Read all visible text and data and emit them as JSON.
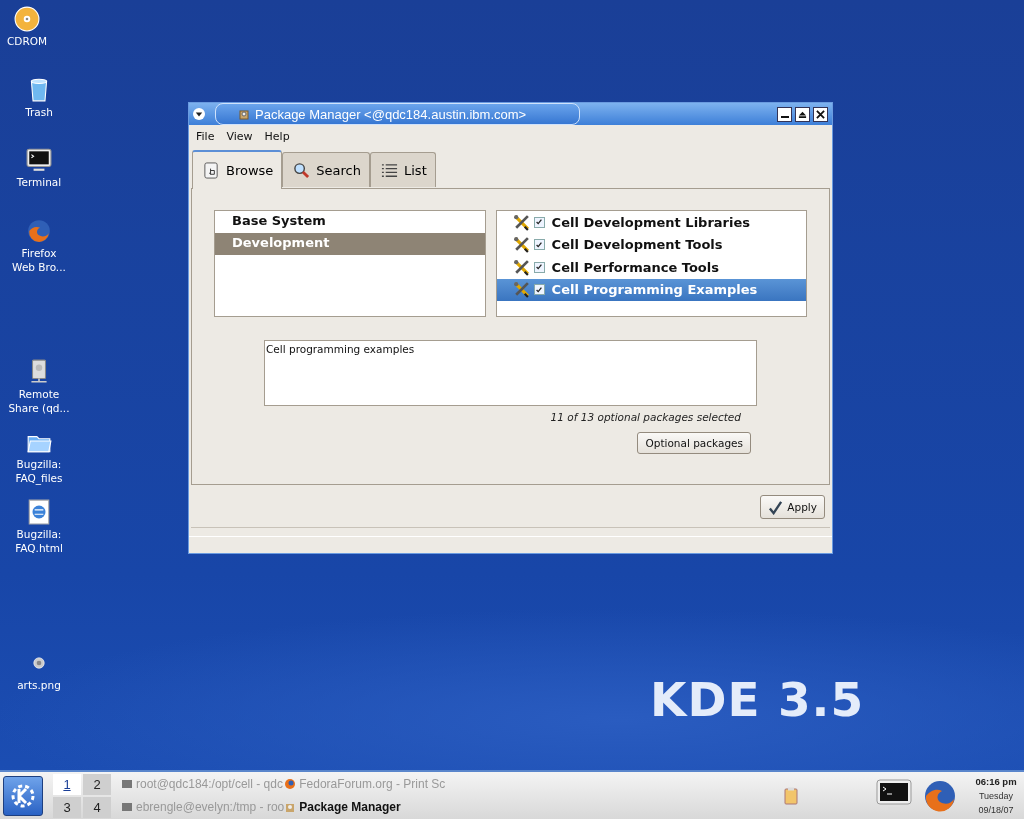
{
  "desktop_icons": [
    {
      "kind": "cdrom",
      "label": [
        "CDROM"
      ]
    },
    {
      "kind": "trash",
      "label": [
        "Trash"
      ]
    },
    {
      "kind": "terminal",
      "label": [
        "Terminal"
      ]
    },
    {
      "kind": "firefox",
      "label": [
        "Firefox",
        "Web Bro..."
      ]
    },
    {
      "kind": "server",
      "label": [
        "Remote",
        "Share (qd..."
      ]
    },
    {
      "kind": "folder",
      "label": [
        "Bugzilla:",
        "FAQ_files"
      ]
    },
    {
      "kind": "webpage",
      "label": [
        "Bugzilla:",
        "FAQ.html"
      ]
    },
    {
      "kind": "image",
      "label": [
        "arts.png"
      ]
    }
  ],
  "wallpaper_text": "KDE 3.5",
  "window": {
    "title": "Package Manager <@qdc184.austin.ibm.com>",
    "menu": [
      "File",
      "View",
      "Help"
    ],
    "tabs": [
      {
        "kind": "browse",
        "label": "Browse",
        "selected": true
      },
      {
        "kind": "search",
        "label": "Search",
        "selected": false
      },
      {
        "kind": "list",
        "label": "List",
        "selected": false
      }
    ],
    "groups": [
      {
        "label": "Base System",
        "selected": false
      },
      {
        "label": "Development",
        "selected": true
      }
    ],
    "packages": [
      {
        "label": "Cell Development Libraries",
        "checked": true,
        "selected": false
      },
      {
        "label": "Cell Development Tools",
        "checked": true,
        "selected": false
      },
      {
        "label": "Cell Performance Tools",
        "checked": true,
        "selected": false
      },
      {
        "label": "Cell Programming Examples",
        "checked": true,
        "selected": true
      }
    ],
    "description": "Cell programming examples",
    "selection_status": "11 of 13 optional packages selected",
    "optional_button": "Optional packages",
    "apply_button": "Apply"
  },
  "taskbar": {
    "desktops": [
      {
        "label": "1",
        "selected": true
      },
      {
        "label": "2",
        "selected": false
      },
      {
        "label": "3",
        "selected": false
      },
      {
        "label": "4",
        "selected": false
      }
    ],
    "tasks": [
      {
        "kind": "terminal",
        "label": "root@qdc184:/opt/cell - qdc",
        "active": false
      },
      {
        "kind": "firefox",
        "label": "FedoraForum.org - Print Sc",
        "active": false
      },
      {
        "kind": "terminal",
        "label": "ebrengle@evelyn:/tmp - roo",
        "active": false
      },
      {
        "kind": "package",
        "label": "Package Manager",
        "active": true
      }
    ],
    "clock": {
      "time": "06:16 pm",
      "day": "Tuesday",
      "date": "09/18/07"
    }
  }
}
